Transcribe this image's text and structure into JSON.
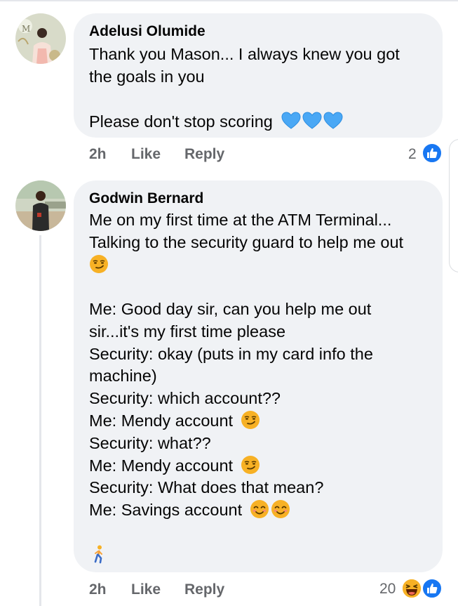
{
  "comments": [
    {
      "author": "Adelusi Olumide",
      "lines": [
        "Thank you Mason... I always knew you got",
        "the goals in you",
        "",
        "Please don't stop scoring"
      ],
      "line_emojis": [
        "",
        "",
        "",
        "blue-heart x3"
      ],
      "time": "2h",
      "like_label": "Like",
      "reply_label": "Reply",
      "reaction_count": "2",
      "reactions": [
        "like-icon"
      ]
    },
    {
      "author": "Godwin Bernard",
      "lines": [
        "Me on my first time at the ATM Terminal...",
        "Talking to the security guard to help me out",
        "",
        "",
        "Me: Good day sir, can you help me out",
        "sir...it's my first time please",
        "Security: okay (puts in my card info the",
        "machine)",
        "Security: which account??",
        "Me: Mendy account",
        "Security: what??",
        "Me: Mendy account",
        "Security: What does that mean?",
        "Me: Savings account",
        "",
        ""
      ],
      "line_emojis": [
        "",
        "",
        "smirking-face",
        "",
        "",
        "",
        "",
        "",
        "",
        "smirking-face",
        "",
        "smirking-face",
        "",
        "smiling-face x2",
        "",
        "person-walking"
      ],
      "time": "2h",
      "like_label": "Like",
      "reply_label": "Reply",
      "reaction_count": "20",
      "reactions": [
        "laughing-face-icon",
        "like-icon"
      ]
    }
  ],
  "colors": {
    "bubble": "#f0f2f5",
    "meta_text": "#65676b",
    "like_blue": "#1877f2",
    "heart_blue": "#4aa8f5",
    "emoji_yellow": "#f7b125"
  }
}
